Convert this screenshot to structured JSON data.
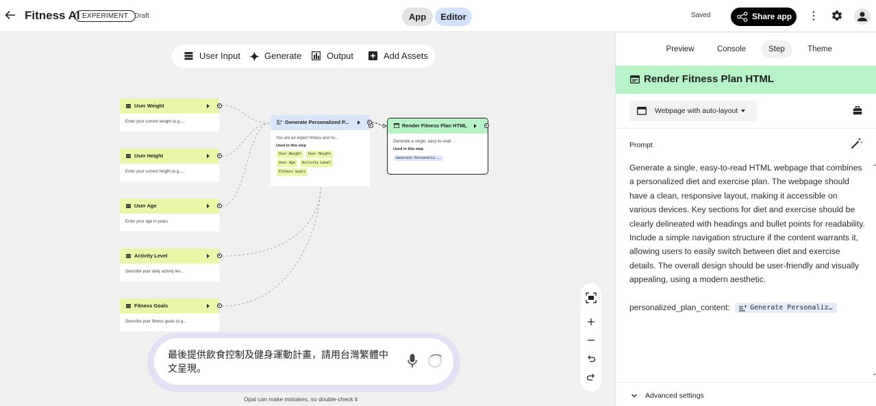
{
  "header": {
    "title": "Fitness AI",
    "badge": "EXPERIMENT",
    "status": "Draft",
    "mode_app": "App",
    "mode_editor": "Editor",
    "saved": "Saved",
    "share": "Share app"
  },
  "toolbar": {
    "user_input": "User Input",
    "generate": "Generate",
    "output": "Output",
    "add_assets": "Add Assets"
  },
  "nodes": {
    "weight": {
      "title": "User Weight",
      "body": "Enter your current weight (e.g.,..."
    },
    "height": {
      "title": "User Height",
      "body": "Enter your current height (e.g.,..."
    },
    "age": {
      "title": "User Age",
      "body": "Enter your age in years"
    },
    "activity": {
      "title": "Activity Level",
      "body": "Describe your daily activity lev..."
    },
    "goals": {
      "title": "Fitness Goals",
      "body": "Describe your fitness goals (e.g..."
    },
    "generate": {
      "title": "Generate Personalized P...",
      "body": "You are an expert fitness and nu...",
      "used_label": "Used in this step",
      "chips": [
        "User Weight",
        "User Height",
        "User Age",
        "Activity Level",
        "Fitness Goals"
      ]
    },
    "render": {
      "title": "Render Fitness Plan HTML",
      "body": "Generate a single, easy-to-read ...",
      "used_label": "Used in this step",
      "chip": "Generate Personaliz..."
    }
  },
  "chat": {
    "text": "最後提供飲食控制及健身運動計畫，請用台灣繁體中文呈現。",
    "disclaimer": "Opal can make mistakes, so double-check it"
  },
  "panel": {
    "tabs": [
      "Preview",
      "Console",
      "Step",
      "Theme"
    ],
    "active_tab": "Step",
    "step_title": "Render Fitness Plan HTML",
    "mode": "Webpage with auto-layout",
    "prompt_label": "Prompt",
    "prompt_text": "Generate a single, easy-to-read HTML webpage that combines a personalized diet and exercise plan. The webpage should have a clean, responsive layout, making it accessible on various devices. Key sections for diet and exercise should be clearly delineated with headings and bullet points for readability. Include a simple navigation structure if the content warrants it, allowing users to easily switch between diet and exercise details. The overall design should be user-friendly and visually appealing, using a modern aesthetic.",
    "var_label": "personalized_plan_content:",
    "var_chip": "Generate Personaliz…",
    "advanced": "Advanced settings"
  },
  "colors": {
    "input_node_header": "#e8f8a8",
    "generate_node_header": "#d9e6fb",
    "render_node_header": "#b7f3c7",
    "step_band": "#b7f3c7",
    "editor_toggle": "#d3e3fd",
    "chat_ring": "#e2e1f6"
  }
}
